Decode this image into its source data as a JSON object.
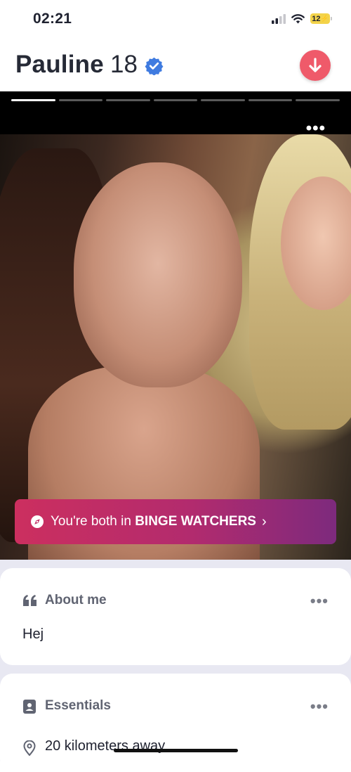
{
  "status_bar": {
    "time": "02:21",
    "battery": "12"
  },
  "profile": {
    "name": "Pauline",
    "age": "18",
    "progress_segments": 7,
    "active_segment": 1,
    "banner": {
      "prefix": "You're both in ",
      "group": "BINGE WATCHERS",
      "chevron": "›"
    }
  },
  "about": {
    "title": "About me",
    "text": "Hej"
  },
  "essentials": {
    "title": "Essentials",
    "distance": "20 kilometers away"
  },
  "icons": [
    "signal-icon",
    "wifi-icon",
    "battery-icon",
    "verified-badge-icon",
    "arrow-down-icon",
    "more-icon",
    "compass-icon",
    "chevron-right-icon",
    "quote-icon",
    "id-card-icon",
    "location-pin-icon"
  ],
  "colors": {
    "accent": "#ef5a6a",
    "banner_start": "#cc2f5f",
    "banner_end": "#7d2a7d",
    "verified": "#3f7be0"
  }
}
